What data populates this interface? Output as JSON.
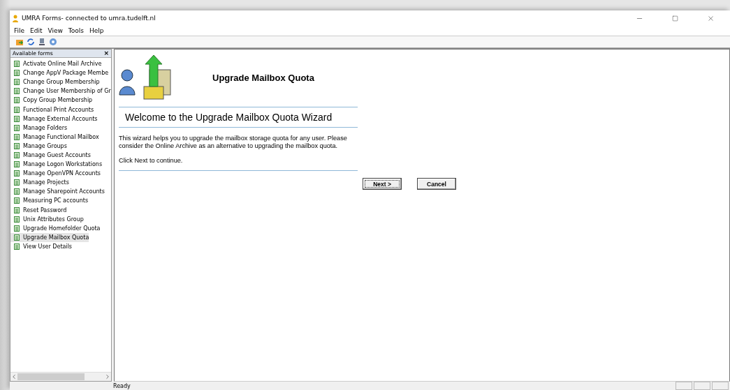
{
  "window": {
    "title": "UMRA Forms- connected to umra.tudelft.nl"
  },
  "menu": [
    "File",
    "Edit",
    "View",
    "Tools",
    "Help"
  ],
  "sidebar": {
    "title": "Available forms",
    "close": "×",
    "items": [
      {
        "label": "Activate Online Mail Archive",
        "selected": false
      },
      {
        "label": "Change AppV Package Membe",
        "selected": false
      },
      {
        "label": "Change Group Membership",
        "selected": false
      },
      {
        "label": "Change User Membership of Gr",
        "selected": false
      },
      {
        "label": "Copy Group Membership",
        "selected": false
      },
      {
        "label": "Functional Print Accounts",
        "selected": false
      },
      {
        "label": "Manage External Accounts",
        "selected": false
      },
      {
        "label": "Manage Folders",
        "selected": false
      },
      {
        "label": "Manage Functional Mailbox",
        "selected": false
      },
      {
        "label": "Manage Groups",
        "selected": false
      },
      {
        "label": "Manage Guest Accounts",
        "selected": false
      },
      {
        "label": "Manage Logon Workstations",
        "selected": false
      },
      {
        "label": "Manage OpenVPN Accounts",
        "selected": false
      },
      {
        "label": "Manage Projects",
        "selected": false
      },
      {
        "label": "Manage Sharepoint Accounts",
        "selected": false
      },
      {
        "label": "Measuring PC accounts",
        "selected": false
      },
      {
        "label": "Reset Password",
        "selected": false
      },
      {
        "label": "Unix Attributes Group",
        "selected": false
      },
      {
        "label": "Upgrade Homefolder Quota",
        "selected": false
      },
      {
        "label": "Upgrade Mailbox Quota",
        "selected": true
      },
      {
        "label": "View User Details",
        "selected": false
      }
    ]
  },
  "wizard": {
    "title": "Upgrade Mailbox Quota",
    "heading": "Welcome to the Upgrade Mailbox Quota Wizard",
    "paragraphs": [
      "This wizard helps you to upgrade the mailbox storage quota for any user. Please consider the Online Archive as an alternative to upgrading the mailbox quota.",
      "Click Next to continue."
    ],
    "buttons": [
      "Next >",
      "Cancel"
    ]
  },
  "status_bar": {
    "text": "Ready"
  }
}
